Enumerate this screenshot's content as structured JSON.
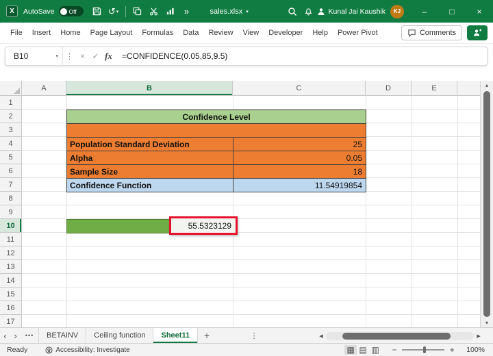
{
  "colors": {
    "titlebar_green": "#107C41",
    "accent_green": "#107C41",
    "table_header_green": "#A9D08E",
    "table_orange": "#ED7D31",
    "table_blue": "#BDD7EE",
    "result_cell_green": "#70AD47",
    "annotation_red": "#E8112D",
    "avatar_orange": "#C07B17"
  },
  "icons": {
    "chevron_down": "▾",
    "undo": "↺",
    "more_chevrons": "»",
    "vertical_ellipsis": "⋮",
    "check": "✓",
    "cancel": "×",
    "tabs_overflow": "•••",
    "nav_left": "‹",
    "nav_right": "›",
    "scroll_left": "◂",
    "scroll_right": "▸",
    "scroll_up": "▴",
    "scroll_down": "▾",
    "add": "+",
    "minimize": "–",
    "maximize": "□",
    "close": "×",
    "view_normal": "▦",
    "view_layout": "▤",
    "view_break": "▥",
    "zoom_out": "−",
    "zoom_in": "+"
  },
  "titlebar": {
    "app_initial": "X",
    "autosave_label": "AutoSave",
    "autosave_state": "Off",
    "filename": "sales.xlsx",
    "user_name": "Kunal Jai Kaushik",
    "user_initials": "KJ"
  },
  "ribbon": {
    "tabs": [
      "File",
      "Insert",
      "Home",
      "Page Layout",
      "Formulas",
      "Data",
      "Review",
      "View",
      "Developer",
      "Help",
      "Power Pivot"
    ],
    "comments_label": "Comments"
  },
  "formula_bar": {
    "name_box": "B10",
    "fx_label": "fx",
    "formula": "=CONFIDENCE(0.05,85,9.5)"
  },
  "grid": {
    "column_headers": [
      "A",
      "B",
      "C",
      "D",
      "E"
    ],
    "row_count": 17,
    "selected_column": "B",
    "selected_row": 10,
    "table": {
      "title": "Confidence Level",
      "rows": [
        {
          "label": "Population Standard Deviation",
          "value": "25"
        },
        {
          "label": "Alpha",
          "value": "0.05"
        },
        {
          "label": "Sample Size",
          "value": "18"
        },
        {
          "label": "Confidence Function",
          "value": "11.54919854"
        }
      ]
    },
    "result_value": "55.5323129"
  },
  "sheet_tabs": {
    "tabs": [
      {
        "label": "BETAINV",
        "active": false
      },
      {
        "label": "Ceiling function",
        "active": false
      },
      {
        "label": "Sheet11",
        "active": true
      }
    ]
  },
  "status_bar": {
    "mode": "Ready",
    "accessibility": "Accessibility: Investigate",
    "zoom_level": "100%"
  }
}
